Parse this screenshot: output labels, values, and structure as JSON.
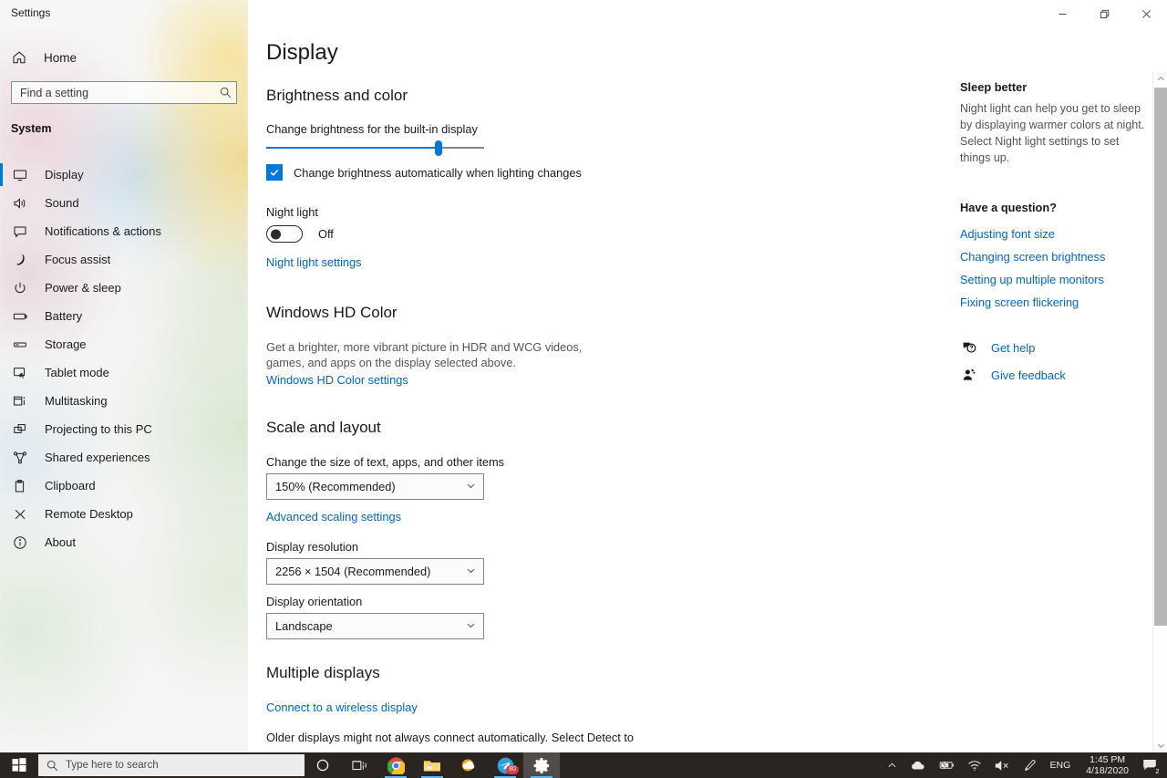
{
  "window": {
    "title": "Settings",
    "minimize_label": "Minimize",
    "restore_label": "Restore",
    "close_label": "Close"
  },
  "sidebar": {
    "home_label": "Home",
    "search_placeholder": "Find a setting",
    "search_value": "",
    "group_header": "System",
    "items": [
      {
        "label": "Display",
        "icon": "monitor-icon",
        "selected": true
      },
      {
        "label": "Sound",
        "icon": "speaker-icon",
        "selected": false
      },
      {
        "label": "Notifications & actions",
        "icon": "chat-icon",
        "selected": false
      },
      {
        "label": "Focus assist",
        "icon": "moon-icon",
        "selected": false
      },
      {
        "label": "Power & sleep",
        "icon": "power-icon",
        "selected": false
      },
      {
        "label": "Battery",
        "icon": "battery-icon",
        "selected": false
      },
      {
        "label": "Storage",
        "icon": "storage-icon",
        "selected": false
      },
      {
        "label": "Tablet mode",
        "icon": "tablet-icon",
        "selected": false
      },
      {
        "label": "Multitasking",
        "icon": "multitasking-icon",
        "selected": false
      },
      {
        "label": "Projecting to this PC",
        "icon": "project-icon",
        "selected": false
      },
      {
        "label": "Shared experiences",
        "icon": "share-icon",
        "selected": false
      },
      {
        "label": "Clipboard",
        "icon": "clipboard-icon",
        "selected": false
      },
      {
        "label": "Remote Desktop",
        "icon": "remote-desktop-icon",
        "selected": false
      },
      {
        "label": "About",
        "icon": "info-icon",
        "selected": false
      }
    ]
  },
  "main": {
    "page_title": "Display",
    "brightness": {
      "section_title": "Brightness and color",
      "slider_label": "Change brightness for the built-in display",
      "slider_percent": 79,
      "auto_checkbox_label": "Change brightness automatically when lighting changes",
      "auto_checkbox_checked": true,
      "night_light_label": "Night light",
      "night_light_state": "Off",
      "night_light_on": false,
      "night_light_settings_link": "Night light settings"
    },
    "hdr": {
      "section_title": "Windows HD Color",
      "description": "Get a brighter, more vibrant picture in HDR and WCG videos, games, and apps on the display selected above.",
      "settings_link": "Windows HD Color settings"
    },
    "scale": {
      "section_title": "Scale and layout",
      "size_label": "Change the size of text, apps, and other items",
      "size_value": "150% (Recommended)",
      "advanced_link": "Advanced scaling settings",
      "resolution_label": "Display resolution",
      "resolution_value": "2256 × 1504 (Recommended)",
      "orientation_label": "Display orientation",
      "orientation_value": "Landscape"
    },
    "multiple": {
      "section_title": "Multiple displays",
      "wireless_link": "Connect to a wireless display",
      "note": "Older displays might not always connect automatically. Select Detect to"
    }
  },
  "rail": {
    "sleep_heading": "Sleep better",
    "sleep_body": "Night light can help you get to sleep by displaying warmer colors at night. Select Night light settings to set things up.",
    "question_heading": "Have a question?",
    "question_links": [
      "Adjusting font size",
      "Changing screen brightness",
      "Setting up multiple monitors",
      "Fixing screen flickering"
    ],
    "get_help": "Get help",
    "give_feedback": "Give feedback"
  },
  "taskbar": {
    "start_label": "Start",
    "search_placeholder": "Type here to search",
    "cortana_label": "Cortana",
    "taskview_label": "Task View",
    "apps": [
      {
        "name": "chrome",
        "label": "Google Chrome",
        "running": true,
        "active": false,
        "badge": ""
      },
      {
        "name": "explorer",
        "label": "File Explorer",
        "running": true,
        "active": false,
        "badge": ""
      },
      {
        "name": "weather",
        "label": "Weather",
        "running": false,
        "active": false,
        "badge": ""
      },
      {
        "name": "telegram",
        "label": "Telegram",
        "running": true,
        "active": false,
        "badge": "80"
      },
      {
        "name": "settings",
        "label": "Settings",
        "running": true,
        "active": true,
        "badge": ""
      }
    ],
    "tray": {
      "show_hidden": "Show hidden icons",
      "onedrive": "OneDrive",
      "battery": "Battery charging",
      "network": "Network",
      "volume": "Volume muted",
      "pen": "Pen menu",
      "language": "ENG",
      "time": "1:45 PM",
      "date": "4/18/2020",
      "notification_count": "2"
    }
  },
  "colors": {
    "accent": "#0078d7",
    "link": "#0067c0",
    "taskbar": "#2b2522",
    "badge_red": "#e8344a"
  }
}
